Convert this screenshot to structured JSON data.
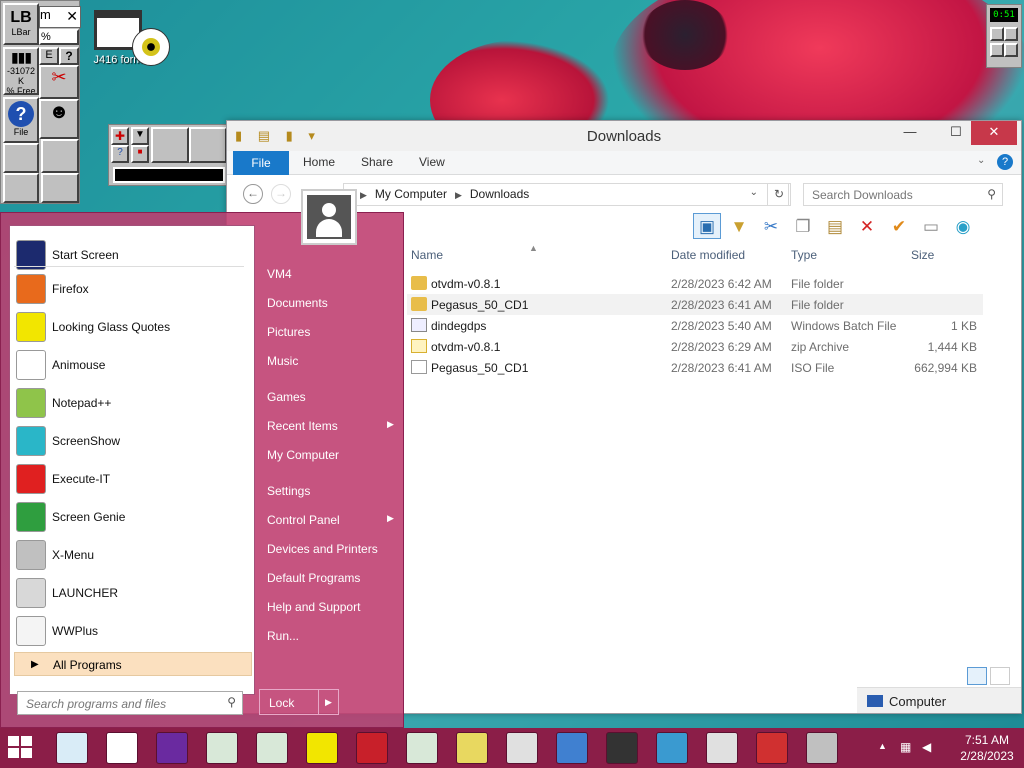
{
  "desktop": {
    "icon_label": "J416 form"
  },
  "lbar": {
    "title": "LBar",
    "memory": "-31072 K",
    "free": "% Free",
    "help_label": "File",
    "mini_window_text": "m",
    "mini_percent": "%"
  },
  "gadget": {
    "time": "0:51"
  },
  "explorer": {
    "title": "Downloads",
    "ribbon_tabs": [
      "File",
      "Home",
      "Share",
      "View"
    ],
    "address": [
      "My Computer",
      "Downloads"
    ],
    "search_placeholder": "Search Downloads",
    "columns": [
      "Name",
      "Date modified",
      "Type",
      "Size"
    ],
    "files": [
      {
        "name": "otvdm-v0.8.1",
        "date": "2/28/2023 6:42 AM",
        "type": "File folder",
        "size": "",
        "icon": "folder-icon"
      },
      {
        "name": "Pegasus_50_CD1",
        "date": "2/28/2023 6:41 AM",
        "type": "File folder",
        "size": "",
        "icon": "folder-icon"
      },
      {
        "name": "dindegdps",
        "date": "2/28/2023 5:40 AM",
        "type": "Windows Batch File",
        "size": "1 KB",
        "icon": "batch-file-icon"
      },
      {
        "name": "otvdm-v0.8.1",
        "date": "2/28/2023 6:29 AM",
        "type": "zip Archive",
        "size": "1,444 KB",
        "icon": "zip-icon"
      },
      {
        "name": "Pegasus_50_CD1",
        "date": "2/28/2023 6:41 AM",
        "type": "ISO File",
        "size": "662,994 KB",
        "icon": "iso-icon"
      }
    ],
    "status_text": "Computer"
  },
  "start_menu": {
    "programs": [
      {
        "label": "Start Screen",
        "color": "#1c2a6e"
      },
      {
        "label": "Firefox",
        "color": "#e86a1c"
      },
      {
        "label": "Looking Glass Quotes",
        "color": "#f2e600"
      },
      {
        "label": "Animouse",
        "color": "#ffffff"
      },
      {
        "label": "Notepad++",
        "color": "#8fc44a"
      },
      {
        "label": "ScreenShow",
        "color": "#2ab6c8"
      },
      {
        "label": "Execute-IT",
        "color": "#e02020"
      },
      {
        "label": "Screen Genie",
        "color": "#2f9e3f"
      },
      {
        "label": "X-Menu",
        "color": "#c0c0c0"
      },
      {
        "label": "LAUNCHER",
        "color": "#d8d8d8"
      },
      {
        "label": "WWPlus",
        "color": "#f4f4f4"
      }
    ],
    "all_programs": "All Programs",
    "search_placeholder": "Search programs and files",
    "right_items": [
      {
        "label": "VM4",
        "arrow": false
      },
      {
        "label": "Documents",
        "arrow": false
      },
      {
        "label": "Pictures",
        "arrow": false
      },
      {
        "label": "Music",
        "arrow": false
      },
      {
        "label": "Games",
        "arrow": false
      },
      {
        "label": "Recent Items",
        "arrow": true
      },
      {
        "label": "My Computer",
        "arrow": false
      },
      {
        "label": "Settings",
        "arrow": false
      },
      {
        "label": "Control Panel",
        "arrow": true
      },
      {
        "label": "Devices and Printers",
        "arrow": false
      },
      {
        "label": "Default Programs",
        "arrow": false
      },
      {
        "label": "Help and Support",
        "arrow": false
      },
      {
        "label": "Run...",
        "arrow": false
      }
    ],
    "lock_label": "Lock"
  },
  "taskbar": {
    "time": "7:51 AM",
    "date": "2/28/2023",
    "items": [
      "#d9ecf7",
      "#ffffff",
      "#6a2aa0",
      "#d8e8d8",
      "#d8e8d8",
      "#f2e600",
      "#c8202a",
      "#d8e8d8",
      "#e8d860",
      "#e0e0e0",
      "#4080d0",
      "#333333",
      "#3a9ad0",
      "#e0e0e0",
      "#d03030",
      "#c0c0c0"
    ]
  }
}
